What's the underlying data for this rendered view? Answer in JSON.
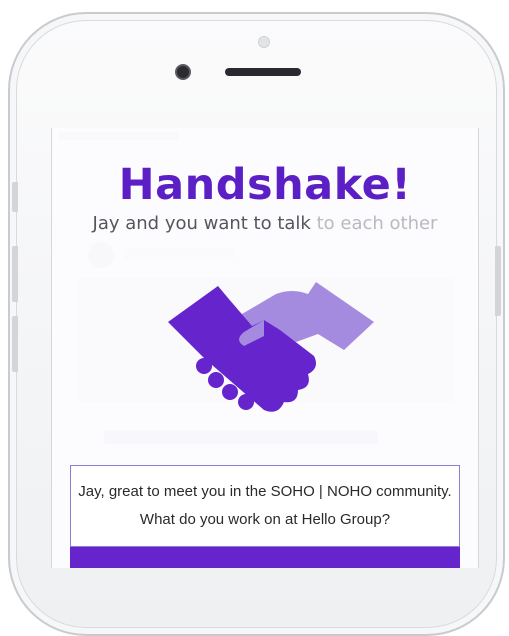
{
  "dialog": {
    "title": "Handshake!",
    "subtitle_main": "Jay and you want to talk ",
    "subtitle_faded": "to each other",
    "message": "Jay, great to meet you in the SOHO | NOHO community. What do you work on at Hello Group?"
  },
  "colors": {
    "accent": "#5b1fc5",
    "handshake_dark": "#6524cc",
    "handshake_light": "#a48be0"
  }
}
